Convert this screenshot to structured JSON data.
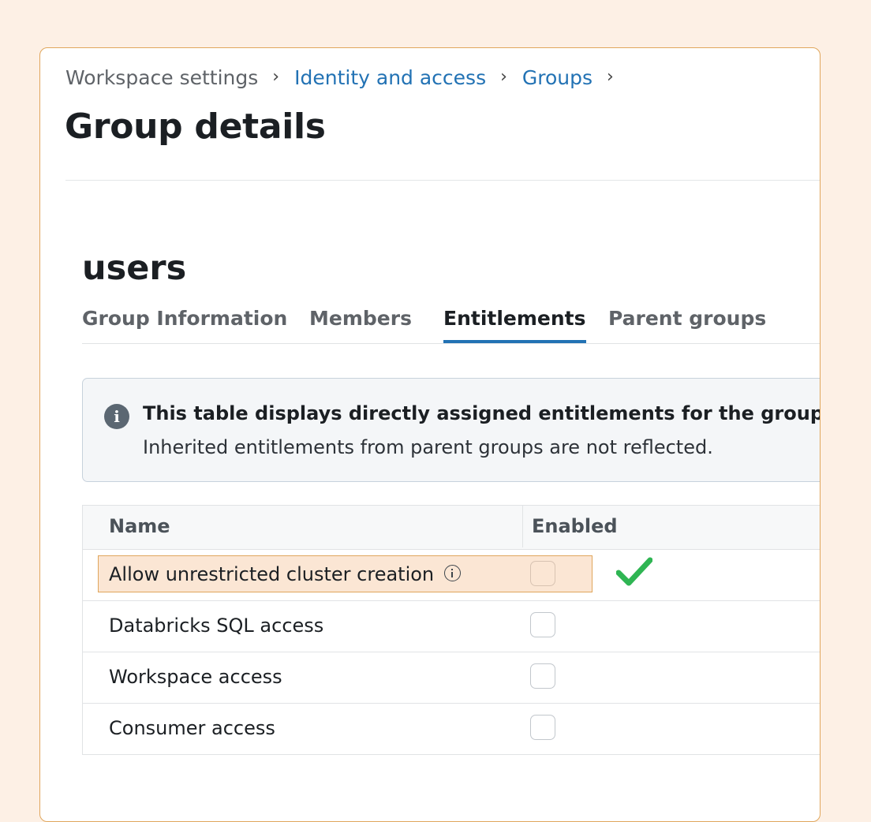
{
  "breadcrumb": {
    "items": [
      "Workspace settings",
      "Identity and access",
      "Groups"
    ],
    "separator": "›"
  },
  "page": {
    "title": "Group details"
  },
  "group": {
    "name": "users"
  },
  "tabs": [
    {
      "label": "Group Information",
      "active": false
    },
    {
      "label": "Members",
      "active": false
    },
    {
      "label": "Entitlements",
      "active": true
    },
    {
      "label": "Parent groups",
      "active": false
    }
  ],
  "banner": {
    "icon": "info-icon",
    "title": "This table displays directly assigned entitlements for the group.",
    "body": "Inherited entitlements from parent groups are not reflected."
  },
  "table": {
    "columns": [
      "Name",
      "Enabled"
    ],
    "rows": [
      {
        "name": "Allow unrestricted cluster creation",
        "enabled": false,
        "has_info_icon": true,
        "highlighted": true
      },
      {
        "name": "Databricks SQL access",
        "enabled": false
      },
      {
        "name": "Workspace access",
        "enabled": false
      },
      {
        "name": "Consumer access",
        "enabled": false
      }
    ]
  },
  "colors": {
    "link": "#2272b4",
    "highlight_fill": "#fbe6d4",
    "highlight_border": "#e0a65c",
    "check_mark": "#2fb553",
    "background": "#fdf0e5"
  }
}
